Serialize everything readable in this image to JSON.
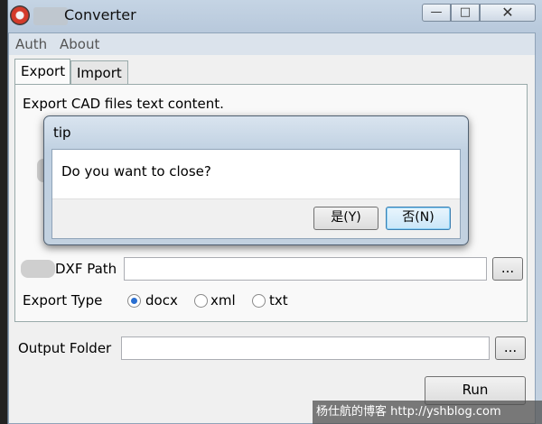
{
  "window": {
    "title": "Converter",
    "minimize": "—",
    "maximize": "□",
    "close": "✕"
  },
  "menu": {
    "items": [
      "Auth",
      "About"
    ]
  },
  "tabs": [
    {
      "label": "Export"
    },
    {
      "label": "Import"
    }
  ],
  "export": {
    "description": "Export CAD files text content.",
    "dxf_path_label": "DXF Path",
    "dxf_path_value": "",
    "browse_label": "...",
    "export_type_label": "Export Type",
    "options": [
      {
        "label": "docx",
        "selected": true
      },
      {
        "label": "xml",
        "selected": false
      },
      {
        "label": "txt",
        "selected": false
      }
    ]
  },
  "output": {
    "label": "Output Folder",
    "value": "",
    "browse_label": "..."
  },
  "run_label": "Run",
  "dialog": {
    "title": "tip",
    "message": "Do you want to close?",
    "yes_label": "是(Y)",
    "no_label": "否(N)"
  },
  "watermark": "杨仕航的博客 http://yshblog.com"
}
